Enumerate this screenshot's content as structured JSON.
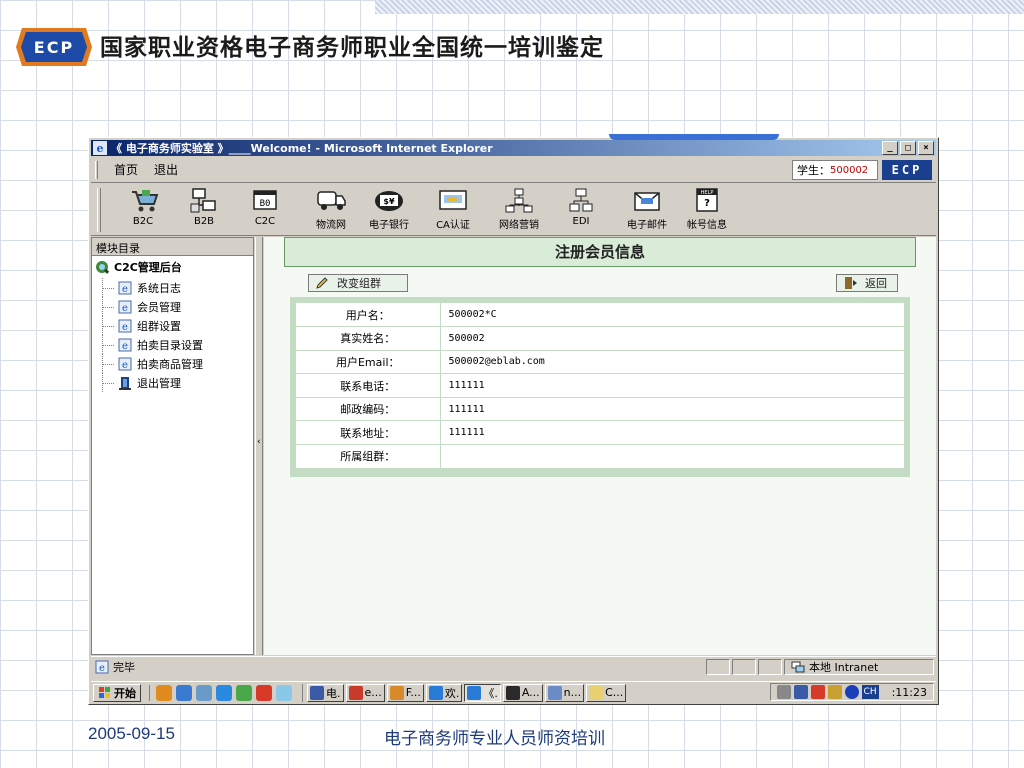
{
  "slide": {
    "title": "国家职业资格电子商务师职业全国统一培训鉴定",
    "logo_text": "ECP",
    "footer_date": "2005-09-15",
    "footer_text": "电子商务师专业人员师资培训"
  },
  "window": {
    "title": "《 电子商务师实验室 》____Welcome! - Microsoft Internet Explorer",
    "minimize": "_",
    "maximize": "□",
    "close": "×"
  },
  "menubar": {
    "home": "首页",
    "logout": "退出",
    "student_label": "学生：",
    "student_id": "500002",
    "brand": "ECP"
  },
  "toolbar": {
    "items": [
      {
        "label": "B2C",
        "icon": "cart-icon"
      },
      {
        "label": "B2B",
        "icon": "network-icon"
      },
      {
        "label": "C2C",
        "icon": "c2c-icon"
      },
      {
        "label": "物流网",
        "icon": "truck-icon"
      },
      {
        "label": "电子银行",
        "icon": "bank-icon"
      },
      {
        "label": "CA认证",
        "icon": "certificate-icon"
      },
      {
        "label": "网络营销",
        "icon": "marketing-icon"
      },
      {
        "label": "EDI",
        "icon": "edi-icon"
      },
      {
        "label": "电子邮件",
        "icon": "mail-icon"
      },
      {
        "label": "帐号信息",
        "icon": "account-help-icon"
      }
    ]
  },
  "sidebar": {
    "header": "模块目录",
    "root": "C2C管理后台",
    "items": [
      {
        "label": "系统日志"
      },
      {
        "label": "会员管理"
      },
      {
        "label": "组群设置"
      },
      {
        "label": "拍卖目录设置"
      },
      {
        "label": "拍卖商品管理"
      },
      {
        "label": "退出管理"
      }
    ]
  },
  "content": {
    "title": "注册会员信息",
    "change_group_button": "改变组群",
    "back_button": "返回",
    "fields": [
      {
        "label": "用户名：",
        "value": "500002*C"
      },
      {
        "label": "真实姓名：",
        "value": "500002"
      },
      {
        "label": "用户Email：",
        "value": "500002@eblab.com"
      },
      {
        "label": "联系电话：",
        "value": "111111"
      },
      {
        "label": "邮政编码：",
        "value": "111111"
      },
      {
        "label": "联系地址：",
        "value": "111111"
      },
      {
        "label": "所属组群：",
        "value": ""
      }
    ]
  },
  "statusbar": {
    "status": "完毕",
    "zone": "本地 Intranet"
  },
  "taskbar": {
    "start": "开始",
    "tasks": [
      {
        "label": "电."
      },
      {
        "label": "e..."
      },
      {
        "label": "F..."
      },
      {
        "label": "欢."
      },
      {
        "label": "《."
      },
      {
        "label": "A..."
      },
      {
        "label": "n..."
      },
      {
        "label": "C..."
      }
    ],
    "lang": "CH",
    "clock": ":11:23"
  },
  "colors": {
    "titlebar_start": "#0a246a",
    "content_header_bg": "#d8ecd8",
    "form_frame": "#c4dcc4",
    "student_id": "#c00000",
    "footer_text": "#1f3a7a"
  }
}
